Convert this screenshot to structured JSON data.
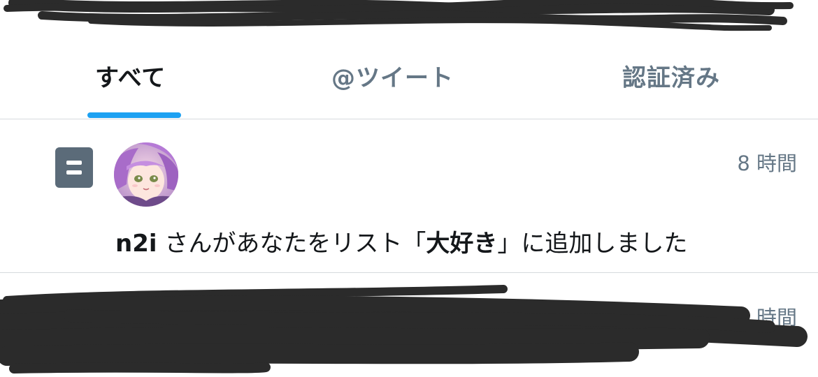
{
  "tabs": [
    {
      "label": "すべて",
      "active": true
    },
    {
      "label": "@ツイート",
      "active": false
    },
    {
      "label": "認証済み",
      "active": false
    }
  ],
  "colors": {
    "accent": "#1da1f2",
    "primary_text": "#14171a",
    "secondary_text": "#657786",
    "list_icon_bg": "#5b6b79",
    "divider": "#d6dadd",
    "redaction": "#2b2b2b"
  },
  "notifications": [
    {
      "icon": "list-icon",
      "time": "8 時間",
      "user": "n2i",
      "text_before": " さんがあなたをリスト「",
      "list_name": "大好き",
      "text_after": "」に追加しました"
    },
    {
      "time": "14 時間"
    }
  ]
}
